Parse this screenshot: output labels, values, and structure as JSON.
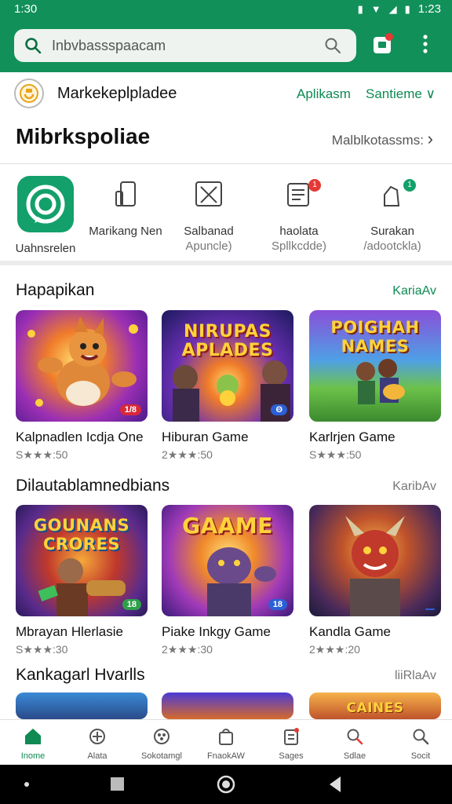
{
  "status": {
    "time": "1:30",
    "clock_right": "1:23"
  },
  "search": {
    "placeholder": "Inbvbassspaacam"
  },
  "marketplace": {
    "title": "Markekeplpladee",
    "link_primary": "Aplikasm",
    "link_secondary": "Santieme ∨"
  },
  "page": {
    "title": "Mibrkspoliae",
    "more": "Malblkotassms:"
  },
  "categories": [
    {
      "label": "Uahnsrelen",
      "sub": "",
      "icon": "app-logo-icon"
    },
    {
      "label": "Marikang Nen",
      "sub": "",
      "icon": "phone-icon"
    },
    {
      "label": "Salbanad",
      "sub": "Apuncle)",
      "icon": "crossed-tools-icon"
    },
    {
      "label": "haolata",
      "sub": "Spllkcdde)",
      "icon": "document-icon",
      "badge": "1"
    },
    {
      "label": "Surakan",
      "sub": "/adootckla)",
      "icon": "lock-icon",
      "badge": "1"
    }
  ],
  "sections": [
    {
      "title": "Hapapikan",
      "more": "KariaAv",
      "items": [
        {
          "name": "Kalpnadlen Icdja One",
          "rating": "S★★★:50",
          "tag": "1/8",
          "art_text": ""
        },
        {
          "name": "Hiburan Game",
          "rating": "2★★★:50",
          "tag": "Θ",
          "art_text": "NIRUPAS APLADES"
        },
        {
          "name": "Karlrjen Game",
          "rating": "S★★★:50",
          "tag": "",
          "art_text": "POIGHAH NAMES"
        }
      ]
    },
    {
      "title": "Dilautablamnedbians",
      "more": "KaribAv",
      "items": [
        {
          "name": "Mbrayan Hlerlasie",
          "rating": "S★★★:30",
          "tag": "18",
          "art_text": "GOUNANS CRORES"
        },
        {
          "name": "Piake Inkgy Game",
          "rating": "2★★★:30",
          "tag": "18",
          "art_text": "GAAME"
        },
        {
          "name": "Kandla Game",
          "rating": "2★★★:20",
          "tag": "",
          "art_text": ""
        }
      ]
    },
    {
      "title": "Kankagarl Hvarlls",
      "more": "liiRlaAv",
      "items": [
        {
          "name": "",
          "rating": "",
          "tag": "",
          "art_text": ""
        },
        {
          "name": "",
          "rating": "",
          "tag": "",
          "art_text": ""
        },
        {
          "name": "",
          "rating": "",
          "tag": "",
          "art_text": "CAINES"
        }
      ]
    }
  ],
  "bottom_nav": [
    {
      "label": "Inome",
      "icon": "home-icon",
      "active": true
    },
    {
      "label": "Alata",
      "icon": "gear-grid-icon"
    },
    {
      "label": "Sokotamgl",
      "icon": "gamepad-icon"
    },
    {
      "label": "FnaokAW",
      "icon": "bag-icon"
    },
    {
      "label": "Sages",
      "icon": "notes-icon"
    },
    {
      "label": "Sdlae",
      "icon": "search-icon"
    },
    {
      "label": "Socit",
      "icon": "search-icon"
    }
  ],
  "colors": {
    "brand_green": "#12905a",
    "accent_green": "#0e8a52"
  }
}
